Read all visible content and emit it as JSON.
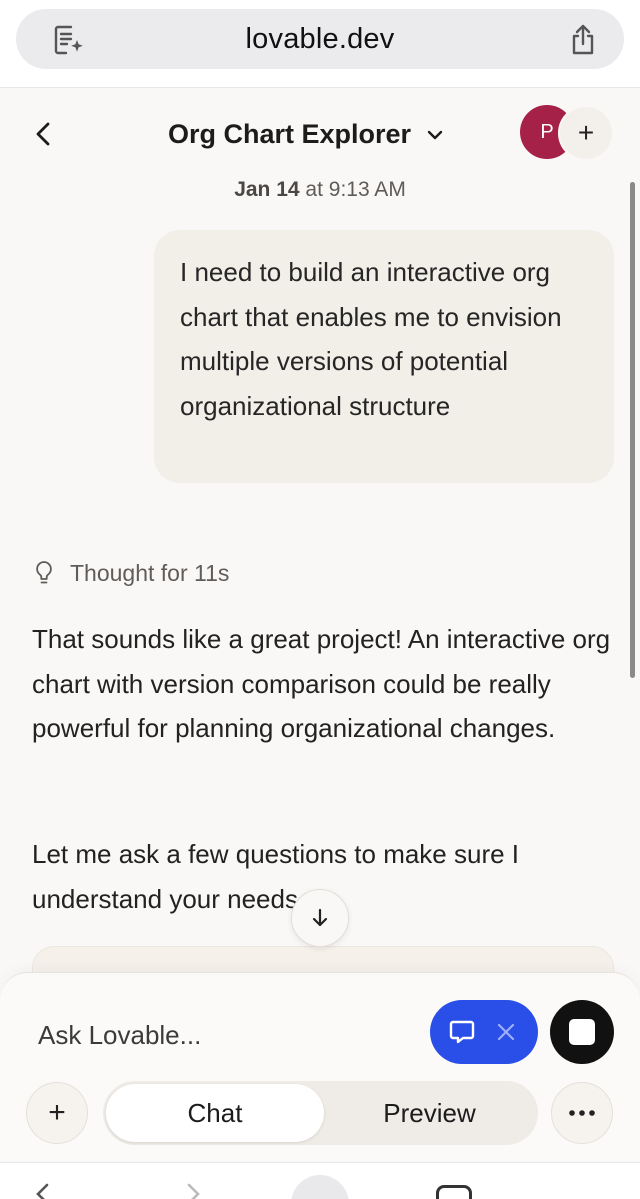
{
  "browser": {
    "url": "lovable.dev"
  },
  "header": {
    "title": "Org Chart Explorer",
    "avatar_initial": "P",
    "add_collaborator": "+"
  },
  "chat": {
    "timestamp_date": "Jan 14",
    "timestamp_time": " at 9:13 AM",
    "user_message": "I need to build an interactive org chart that enables me to envision multiple versions of potential organizational structure",
    "thought_label": "Thought for 11s",
    "assistant_paragraph_1": "That sounds like a great project! An interactive org chart with version comparison could be really powerful for planning organizational changes.",
    "assistant_paragraph_2": "Let me ask a few questions to make sure I understand your needs"
  },
  "composer": {
    "placeholder": "Ask Lovable...",
    "add_label": "+",
    "tab_chat": "Chat",
    "tab_preview": "Preview",
    "accent_color": "#2a4ee8"
  },
  "icons": {
    "url_left": "reader-sparkle-icon",
    "share": "share-icon",
    "back": "chevron-left-icon",
    "title_dropdown": "chevron-down-icon",
    "thought": "lightbulb-icon",
    "scroll_down": "arrow-down-icon",
    "chat_mode": "speech-bubble-icon",
    "close": "close-icon",
    "stop": "stop-icon",
    "more": "ellipsis-icon"
  }
}
